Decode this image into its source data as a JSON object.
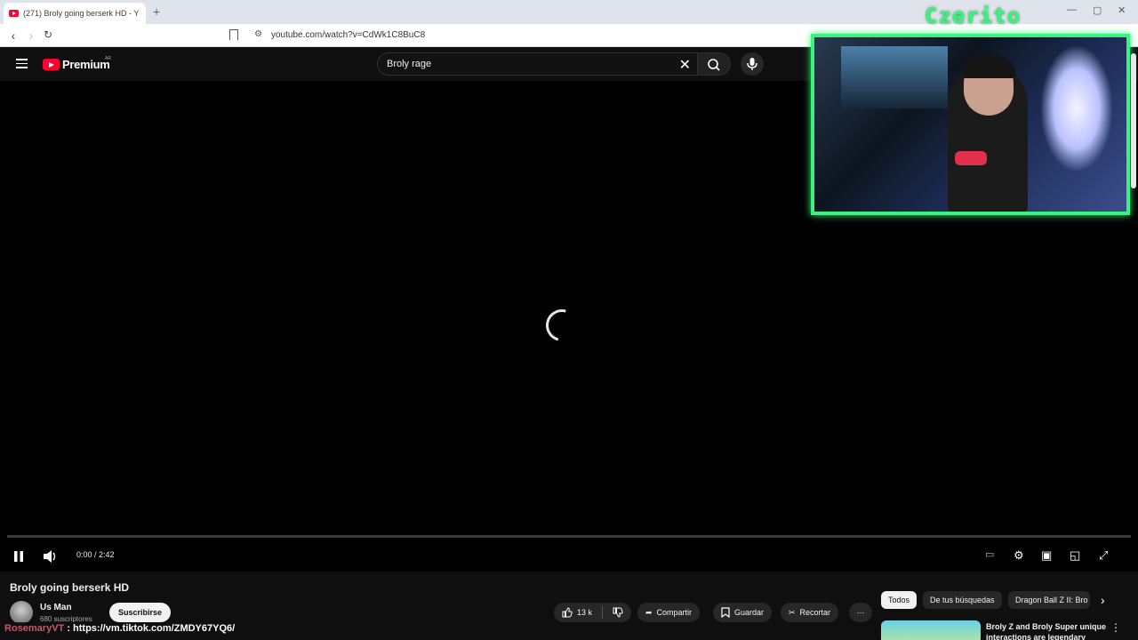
{
  "browser": {
    "tab_title": "(271) Broly going berserk HD - Y",
    "new_tab_label": "+",
    "url": "youtube.com/watch?v=CdWk1C8BuC8"
  },
  "header": {
    "logo_text": "Premium",
    "region": "AR",
    "search_query": "Broly rage"
  },
  "player": {
    "current_time": "0:00",
    "duration": "2:42",
    "time_display": "0:00 / 2:42",
    "progress": 0
  },
  "webcam": {
    "streamer_name": "Czerito"
  },
  "video": {
    "title": "Broly going berserk HD",
    "channel": "Us Man",
    "subscribers": "680 suscriptores",
    "subscribe_label": "Suscribirse",
    "likes": "13 k",
    "share_label": "Compartir",
    "save_label": "Guardar",
    "clip_label": "Recortar"
  },
  "chips": [
    {
      "label": "Todos",
      "active": true
    },
    {
      "label": "De tus búsquedas",
      "active": false
    },
    {
      "label": "Dragon Ball Z II: Bro",
      "active": false
    }
  ],
  "recommendation": {
    "title": "Broly Z and Broly Super unique interactions are legendary"
  },
  "chat": {
    "user": "RosemaryVT",
    "separator": " : ",
    "message": "https://vm.tiktok.com/ZMDY67YQ6/"
  },
  "colors": {
    "webcam_border": "#39f37c",
    "youtube_red": "#ff0033",
    "chat_user": "#c9566a"
  }
}
